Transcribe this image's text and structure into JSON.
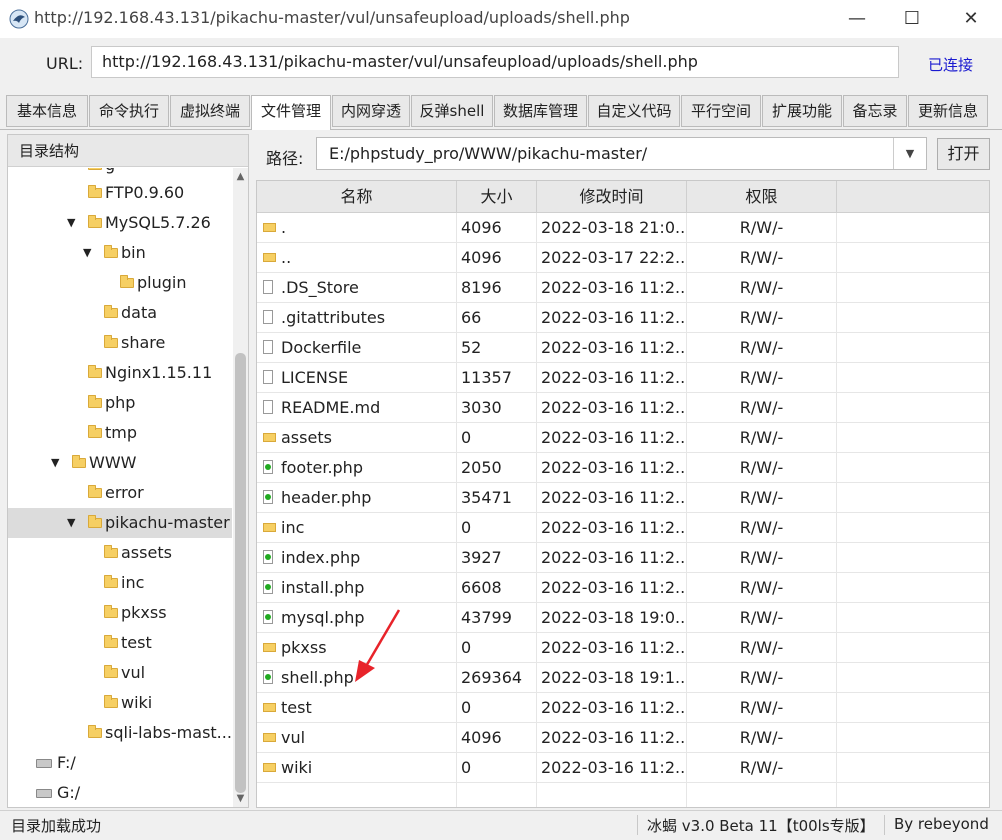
{
  "window": {
    "title": "http://192.168.43.131/pikachu-master/vul/unsafeupload/uploads/shell.php",
    "minimize": "—",
    "maximize": "☐",
    "close": "✕"
  },
  "url_bar": {
    "label": "URL:",
    "value": "http://192.168.43.131/pikachu-master/vul/unsafeupload/uploads/shell.php",
    "status": "已连接"
  },
  "tabs": [
    {
      "label": "基本信息"
    },
    {
      "label": "命令执行"
    },
    {
      "label": "虚拟终端"
    },
    {
      "label": "文件管理",
      "active": true
    },
    {
      "label": "内网穿透"
    },
    {
      "label": "反弹shell"
    },
    {
      "label": "数据库管理"
    },
    {
      "label": "自定义代码"
    },
    {
      "label": "平行空间"
    },
    {
      "label": "扩展功能"
    },
    {
      "label": "备忘录"
    },
    {
      "label": "更新信息"
    }
  ],
  "tree": {
    "header": "目录结构",
    "items": [
      {
        "label": "g",
        "type": "folder"
      },
      {
        "label": "FTP0.9.60",
        "type": "folder"
      },
      {
        "label": "MySQL5.7.26",
        "type": "folder",
        "expanded": true
      },
      {
        "label": "bin",
        "type": "folder",
        "expanded": true
      },
      {
        "label": "plugin",
        "type": "folder"
      },
      {
        "label": "data",
        "type": "folder"
      },
      {
        "label": "share",
        "type": "folder"
      },
      {
        "label": "Nginx1.15.11",
        "type": "folder"
      },
      {
        "label": "php",
        "type": "folder"
      },
      {
        "label": "tmp",
        "type": "folder"
      },
      {
        "label": "WWW",
        "type": "folder",
        "expanded": true
      },
      {
        "label": "error",
        "type": "folder"
      },
      {
        "label": "pikachu-master",
        "type": "folder",
        "expanded": true,
        "selected": true
      },
      {
        "label": "assets",
        "type": "folder"
      },
      {
        "label": "inc",
        "type": "folder"
      },
      {
        "label": "pkxss",
        "type": "folder"
      },
      {
        "label": "test",
        "type": "folder"
      },
      {
        "label": "vul",
        "type": "folder"
      },
      {
        "label": "wiki",
        "type": "folder"
      },
      {
        "label": "sqli-labs-mast...",
        "type": "folder"
      },
      {
        "label": "F:/",
        "type": "drive"
      },
      {
        "label": "G:/",
        "type": "drive"
      }
    ]
  },
  "path_bar": {
    "label": "路径:",
    "value": "E:/phpstudy_pro/WWW/pikachu-master/",
    "open_label": "打开"
  },
  "file_table": {
    "columns": [
      "名称",
      "大小",
      "修改时间",
      "权限"
    ],
    "rows": [
      {
        "name": ".",
        "size": "4096",
        "mtime": "2022-03-18 21:0...",
        "perm": "R/W/-",
        "kind": "folder"
      },
      {
        "name": "..",
        "size": "4096",
        "mtime": "2022-03-17 22:2...",
        "perm": "R/W/-",
        "kind": "folder"
      },
      {
        "name": ".DS_Store",
        "size": "8196",
        "mtime": "2022-03-16 11:2...",
        "perm": "R/W/-",
        "kind": "file"
      },
      {
        "name": ".gitattributes",
        "size": "66",
        "mtime": "2022-03-16 11:2...",
        "perm": "R/W/-",
        "kind": "file"
      },
      {
        "name": "Dockerfile",
        "size": "52",
        "mtime": "2022-03-16 11:2...",
        "perm": "R/W/-",
        "kind": "file"
      },
      {
        "name": "LICENSE",
        "size": "11357",
        "mtime": "2022-03-16 11:2...",
        "perm": "R/W/-",
        "kind": "file"
      },
      {
        "name": "README.md",
        "size": "3030",
        "mtime": "2022-03-16 11:2...",
        "perm": "R/W/-",
        "kind": "file"
      },
      {
        "name": "assets",
        "size": "0",
        "mtime": "2022-03-16 11:2...",
        "perm": "R/W/-",
        "kind": "folder"
      },
      {
        "name": "footer.php",
        "size": "2050",
        "mtime": "2022-03-16 11:2...",
        "perm": "R/W/-",
        "kind": "php"
      },
      {
        "name": "header.php",
        "size": "35471",
        "mtime": "2022-03-16 11:2...",
        "perm": "R/W/-",
        "kind": "php"
      },
      {
        "name": "inc",
        "size": "0",
        "mtime": "2022-03-16 11:2...",
        "perm": "R/W/-",
        "kind": "folder"
      },
      {
        "name": "index.php",
        "size": "3927",
        "mtime": "2022-03-16 11:2...",
        "perm": "R/W/-",
        "kind": "php"
      },
      {
        "name": "install.php",
        "size": "6608",
        "mtime": "2022-03-16 11:2...",
        "perm": "R/W/-",
        "kind": "php"
      },
      {
        "name": "mysql.php",
        "size": "43799",
        "mtime": "2022-03-18 19:0...",
        "perm": "R/W/-",
        "kind": "php"
      },
      {
        "name": "pkxss",
        "size": "0",
        "mtime": "2022-03-16 11:2...",
        "perm": "R/W/-",
        "kind": "folder"
      },
      {
        "name": "shell.php",
        "size": "269364",
        "mtime": "2022-03-18 19:1...",
        "perm": "R/W/-",
        "kind": "php"
      },
      {
        "name": "test",
        "size": "0",
        "mtime": "2022-03-16 11:2...",
        "perm": "R/W/-",
        "kind": "folder"
      },
      {
        "name": "vul",
        "size": "4096",
        "mtime": "2022-03-16 11:2...",
        "perm": "R/W/-",
        "kind": "folder"
      },
      {
        "name": "wiki",
        "size": "0",
        "mtime": "2022-03-16 11:2...",
        "perm": "R/W/-",
        "kind": "folder"
      }
    ]
  },
  "status_bar": {
    "message": "目录加载成功",
    "version": "冰蝎 v3.0 Beta 11【t00ls专版】",
    "author": "By rebeyond"
  },
  "colors": {
    "link": "#1a1ad0",
    "arrow": "#e8232a",
    "folder": "#f6cf63"
  },
  "icons": {
    "app": "scorpion-logo-icon",
    "folder": "folder-icon",
    "file": "file-icon",
    "php": "php-file-icon",
    "drive": "drive-icon"
  }
}
